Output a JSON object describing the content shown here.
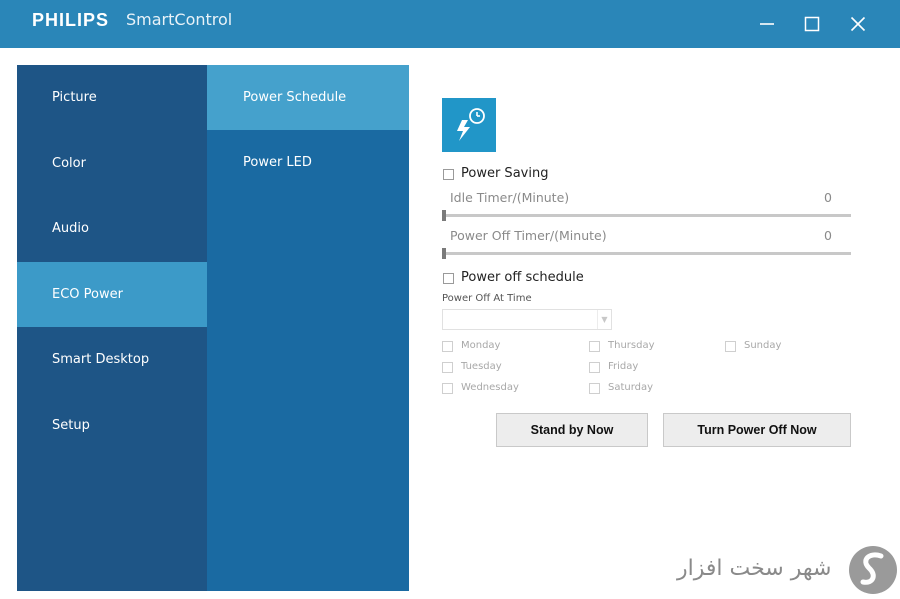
{
  "titlebar": {
    "brand": "PHILIPS",
    "app_name": "SmartControl",
    "bg_color": "#2a86b8"
  },
  "nav_primary": {
    "items": [
      {
        "label": "Picture",
        "active": false
      },
      {
        "label": "Color",
        "active": false
      },
      {
        "label": "Audio",
        "active": false
      },
      {
        "label": "ECO Power",
        "active": true
      },
      {
        "label": "Smart Desktop",
        "active": false
      },
      {
        "label": "Setup",
        "active": false
      }
    ]
  },
  "nav_secondary": {
    "items": [
      {
        "label": "Power Schedule",
        "active": true
      },
      {
        "label": "Power LED",
        "active": false
      }
    ]
  },
  "panel": {
    "tile_icon": "power-clock-icon",
    "power_saving": {
      "label": "Power Saving",
      "checked": false,
      "idle_timer_label": "Idle Timer/(Minute)",
      "idle_timer_value": "0",
      "power_off_timer_label": "Power Off Timer/(Minute)",
      "power_off_timer_value": "0"
    },
    "power_off_schedule": {
      "label": "Power off schedule",
      "checked": false,
      "time_label": "Power Off At Time",
      "time_value": "",
      "days": [
        {
          "label": "Monday",
          "checked": false
        },
        {
          "label": "Tuesday",
          "checked": false
        },
        {
          "label": "Wednesday",
          "checked": false
        },
        {
          "label": "Thursday",
          "checked": false
        },
        {
          "label": "Friday",
          "checked": false
        },
        {
          "label": "Saturday",
          "checked": false
        },
        {
          "label": "Sunday",
          "checked": false
        }
      ]
    },
    "buttons": {
      "standby": "Stand by Now",
      "power_off": "Turn Power Off Now"
    }
  },
  "watermark": {
    "text": "شهر سخت افزار"
  },
  "colors": {
    "nav_primary_bg": "#1e5586",
    "nav_primary_active": "#3c9ac8",
    "nav_secondary_bg": "#1a6aa2",
    "nav_secondary_active": "#45a1cc",
    "tile_bg": "#2196c8"
  }
}
